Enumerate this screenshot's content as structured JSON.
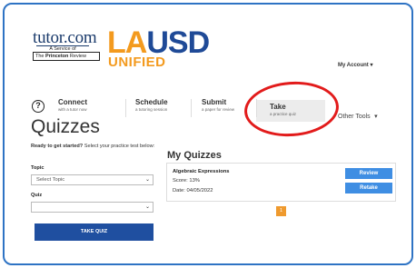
{
  "brand": {
    "tutor_word": "tutor.com",
    "tutor_service": "A Service of",
    "tutor_pr_prefix": "The ",
    "tutor_pr_bold": "Princeton",
    "tutor_pr_suffix": " Review",
    "district_letters": [
      "L",
      "A",
      "U",
      "S",
      "D"
    ],
    "district_sub": "UNIFIED"
  },
  "account": {
    "label": "My Account",
    "caret": "▾"
  },
  "nav": {
    "help_glyph": "?",
    "items": [
      {
        "title": "Connect",
        "sub": "with a tutor now"
      },
      {
        "title": "Schedule",
        "sub": "a tutoring session"
      },
      {
        "title": "Submit",
        "sub": "a paper for review"
      },
      {
        "title": "Take",
        "sub": "a practice quiz"
      }
    ],
    "other": {
      "label": "Other Tools",
      "caret": "▾"
    }
  },
  "page": {
    "title": "Quizzes"
  },
  "form": {
    "intro_bold": "Ready to get started?",
    "intro_rest": " Select your practice test below:",
    "topic_label": "Topic",
    "topic_value": "Select Topic",
    "quiz_label": "Quiz",
    "quiz_value": "",
    "take_button": "TAKE QUIZ"
  },
  "my_quizzes": {
    "title": "My Quizzes",
    "items": [
      {
        "name": "Algebraic Expressions",
        "score": "Score: 13%",
        "date": "Date: 04/05/2022",
        "review_label": "Review",
        "retake_label": "Retake"
      }
    ],
    "pagination": {
      "current": "1"
    }
  },
  "colors": {
    "frame": "#2e73c4",
    "annotation_circle": "#e21b1b",
    "primary_button": "#1f4fa0",
    "action_button": "#3f8ee3",
    "pager": "#ef9a2e",
    "district_orange": "#f39a1e",
    "district_blue": "#1f4a97"
  }
}
